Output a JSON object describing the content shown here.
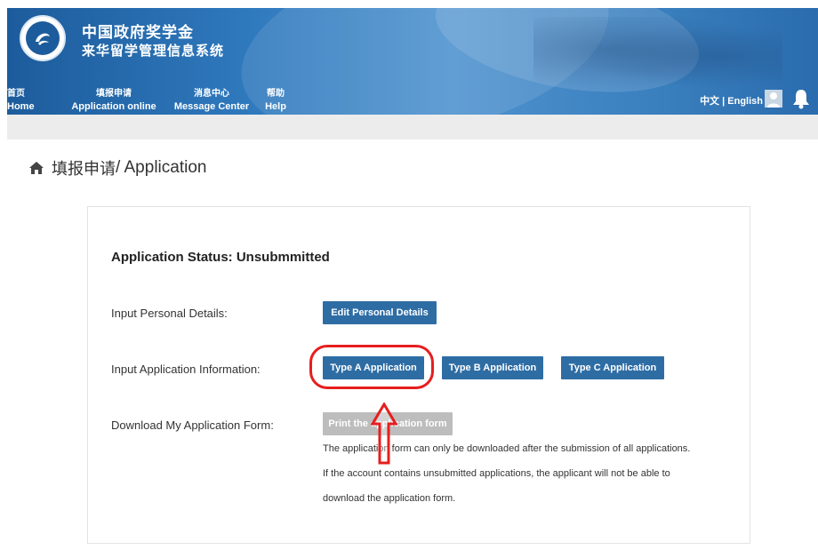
{
  "header": {
    "brand_line1": "中国政府奖学金",
    "brand_line2": "来华留学管理信息系统",
    "nav": [
      {
        "cn": "首页",
        "en": "Home"
      },
      {
        "cn": "填报申请",
        "en": "Application online"
      },
      {
        "cn": "消息中心",
        "en": "Message Center"
      },
      {
        "cn": "帮助",
        "en": "Help"
      }
    ],
    "lang_cn": "中文",
    "lang_sep": " | ",
    "lang_en": "English"
  },
  "page": {
    "title_cn": "填报申请",
    "title_en": " / Application"
  },
  "card": {
    "status": "Application Status: Unsubmmitted",
    "rows": {
      "personal_label": "Input Personal Details:",
      "personal_button": "Edit Personal Details",
      "application_label": "Input Application Information:",
      "type_a": "Type A Application",
      "type_b": "Type B Application",
      "type_c": "Type C Application",
      "download_label": "Download My Application Form:",
      "print_button": "Print the application form"
    },
    "notes": [
      "The application form can only be downloaded after the submission of all applications.",
      "If the account contains unsubmitted applications, the applicant will not be able to",
      "download the application form."
    ]
  },
  "colors": {
    "header_blue": "#2f79bd",
    "button_blue": "#2e6da4",
    "disabled_gray": "#bdbdbd",
    "annotation_red": "#e61e1e"
  }
}
